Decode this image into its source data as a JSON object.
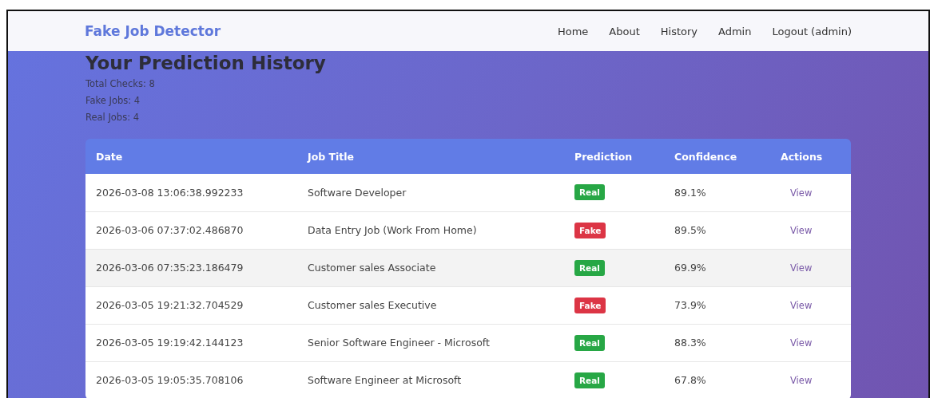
{
  "navbar": {
    "brand": "Fake Job Detector",
    "links": [
      "Home",
      "About",
      "History",
      "Admin",
      "Logout (admin)"
    ]
  },
  "heading": "Your Prediction History",
  "stats": [
    "Total Checks: 8",
    "Fake Jobs: 4",
    "Real Jobs: 4"
  ],
  "table": {
    "columns": [
      "Date",
      "Job Title",
      "Prediction",
      "Confidence",
      "Actions"
    ],
    "rows": [
      {
        "date": "2026-03-08 13:06:38.992233",
        "job_title": "Software Developer",
        "prediction": {
          "label": "Real",
          "kind": "real"
        },
        "confidence": "89.1%",
        "action": "View",
        "highlighted": false
      },
      {
        "date": "2026-03-06 07:37:02.486870",
        "job_title": "Data Entry Job (Work From Home)",
        "prediction": {
          "label": "Fake",
          "kind": "fake"
        },
        "confidence": "89.5%",
        "action": "View",
        "highlighted": false
      },
      {
        "date": "2026-03-06 07:35:23.186479",
        "job_title": "Customer sales Associate",
        "prediction": {
          "label": "Real",
          "kind": "real"
        },
        "confidence": "69.9%",
        "action": "View",
        "highlighted": true
      },
      {
        "date": "2026-03-05 19:21:32.704529",
        "job_title": "Customer sales Executive",
        "prediction": {
          "label": "Fake",
          "kind": "fake"
        },
        "confidence": "73.9%",
        "action": "View",
        "highlighted": false
      },
      {
        "date": "2026-03-05 19:19:42.144123",
        "job_title": "Senior Software Engineer - Microsoft",
        "prediction": {
          "label": "Real",
          "kind": "real"
        },
        "confidence": "88.3%",
        "action": "View",
        "highlighted": false
      },
      {
        "date": "2026-03-05 19:05:35.708106",
        "job_title": "Software Engineer at Microsoft",
        "prediction": {
          "label": "Real",
          "kind": "real"
        },
        "confidence": "67.8%",
        "action": "View",
        "highlighted": false
      }
    ]
  }
}
